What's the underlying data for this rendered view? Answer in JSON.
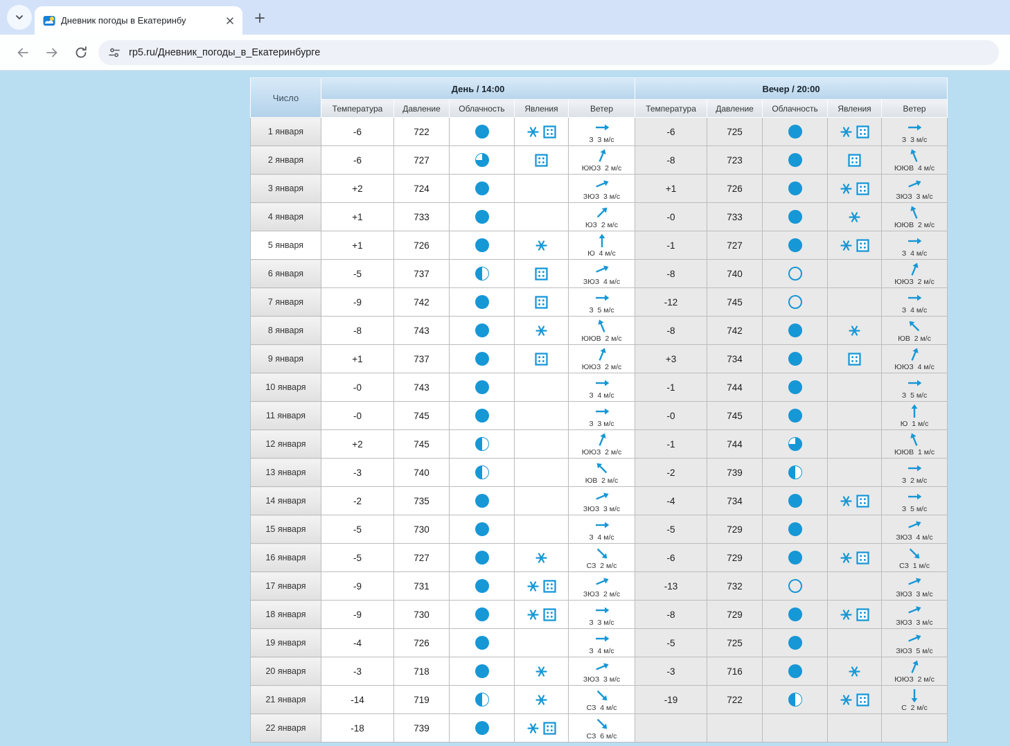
{
  "browser": {
    "tab_title": "Дневник погоды в Екатеринбу",
    "url": "rp5.ru/Дневник_погоды_в_Екатеринбурге"
  },
  "colors": {
    "accent": "#1697d6",
    "page_background": "#b9def2",
    "header_blue_top": "#d8eaf8",
    "header_blue_bottom": "#b7d4eb",
    "evening_cell": "#e9e9e9"
  },
  "table": {
    "date_header": "Число",
    "groups": [
      {
        "label": "День / 14:00"
      },
      {
        "label": "Вечер / 20:00"
      }
    ],
    "columns": [
      "Температура",
      "Давление",
      "Облачность",
      "Явления",
      "Ветер"
    ],
    "wind_unit": "м/с",
    "cloud_legend": {
      "overcast": "сплошная облачность",
      "mostly": "облачно",
      "half": "переменная облачность",
      "clear": "ясно"
    },
    "rows": [
      {
        "date": "1 января",
        "highlighted": false,
        "day": {
          "temp": "-6",
          "pressure": "722",
          "cloud": "overcast",
          "phenomena": [
            "snowflake",
            "dotted-box"
          ],
          "wind_dir": "З",
          "wind_speed": "3"
        },
        "evening": {
          "temp": "-6",
          "pressure": "725",
          "cloud": "overcast",
          "phenomena": [
            "snowflake",
            "dotted-box"
          ],
          "wind_dir": "З",
          "wind_speed": "3"
        }
      },
      {
        "date": "2 января",
        "highlighted": false,
        "day": {
          "temp": "-6",
          "pressure": "727",
          "cloud": "mostly",
          "phenomena": [
            "dotted-box"
          ],
          "wind_dir": "ЮЮЗ",
          "wind_speed": "2"
        },
        "evening": {
          "temp": "-8",
          "pressure": "723",
          "cloud": "overcast",
          "phenomena": [
            "dotted-box"
          ],
          "wind_dir": "ЮЮВ",
          "wind_speed": "4"
        }
      },
      {
        "date": "3 января",
        "highlighted": false,
        "day": {
          "temp": "+2",
          "pressure": "724",
          "cloud": "overcast",
          "phenomena": [],
          "wind_dir": "ЗЮЗ",
          "wind_speed": "3"
        },
        "evening": {
          "temp": "+1",
          "pressure": "726",
          "cloud": "overcast",
          "phenomena": [
            "snowflake",
            "dotted-box"
          ],
          "wind_dir": "ЗЮЗ",
          "wind_speed": "3"
        }
      },
      {
        "date": "4 января",
        "highlighted": false,
        "day": {
          "temp": "+1",
          "pressure": "733",
          "cloud": "overcast",
          "phenomena": [],
          "wind_dir": "ЮЗ",
          "wind_speed": "2"
        },
        "evening": {
          "temp": "-0",
          "pressure": "733",
          "cloud": "overcast",
          "phenomena": [
            "snowflake"
          ],
          "wind_dir": "ЮЮВ",
          "wind_speed": "2"
        }
      },
      {
        "date": "5 января",
        "highlighted": true,
        "day": {
          "temp": "+1",
          "pressure": "726",
          "cloud": "overcast",
          "phenomena": [
            "snowflake"
          ],
          "wind_dir": "Ю",
          "wind_speed": "4"
        },
        "evening": {
          "temp": "-1",
          "pressure": "727",
          "cloud": "overcast",
          "phenomena": [
            "snowflake",
            "dotted-box"
          ],
          "wind_dir": "З",
          "wind_speed": "4"
        }
      },
      {
        "date": "6 января",
        "highlighted": false,
        "day": {
          "temp": "-5",
          "pressure": "737",
          "cloud": "half",
          "phenomena": [
            "dotted-box"
          ],
          "wind_dir": "ЗЮЗ",
          "wind_speed": "4"
        },
        "evening": {
          "temp": "-8",
          "pressure": "740",
          "cloud": "clear",
          "phenomena": [],
          "wind_dir": "ЮЮЗ",
          "wind_speed": "2"
        }
      },
      {
        "date": "7 января",
        "highlighted": false,
        "day": {
          "temp": "-9",
          "pressure": "742",
          "cloud": "overcast",
          "phenomena": [
            "dotted-box"
          ],
          "wind_dir": "З",
          "wind_speed": "5"
        },
        "evening": {
          "temp": "-12",
          "pressure": "745",
          "cloud": "clear",
          "phenomena": [],
          "wind_dir": "З",
          "wind_speed": "4"
        }
      },
      {
        "date": "8 января",
        "highlighted": false,
        "day": {
          "temp": "-8",
          "pressure": "743",
          "cloud": "overcast",
          "phenomena": [
            "snowflake"
          ],
          "wind_dir": "ЮЮВ",
          "wind_speed": "2"
        },
        "evening": {
          "temp": "-8",
          "pressure": "742",
          "cloud": "overcast",
          "phenomena": [
            "snowflake"
          ],
          "wind_dir": "ЮВ",
          "wind_speed": "2"
        }
      },
      {
        "date": "9 января",
        "highlighted": false,
        "day": {
          "temp": "+1",
          "pressure": "737",
          "cloud": "overcast",
          "phenomena": [
            "dotted-box"
          ],
          "wind_dir": "ЮЮЗ",
          "wind_speed": "2"
        },
        "evening": {
          "temp": "+3",
          "pressure": "734",
          "cloud": "overcast",
          "phenomena": [
            "dotted-box"
          ],
          "wind_dir": "ЮЮЗ",
          "wind_speed": "4"
        }
      },
      {
        "date": "10 января",
        "highlighted": false,
        "day": {
          "temp": "-0",
          "pressure": "743",
          "cloud": "overcast",
          "phenomena": [],
          "wind_dir": "З",
          "wind_speed": "4"
        },
        "evening": {
          "temp": "-1",
          "pressure": "744",
          "cloud": "overcast",
          "phenomena": [],
          "wind_dir": "З",
          "wind_speed": "5"
        }
      },
      {
        "date": "11 января",
        "highlighted": false,
        "day": {
          "temp": "-0",
          "pressure": "745",
          "cloud": "overcast",
          "phenomena": [],
          "wind_dir": "З",
          "wind_speed": "3"
        },
        "evening": {
          "temp": "-0",
          "pressure": "745",
          "cloud": "overcast",
          "phenomena": [],
          "wind_dir": "Ю",
          "wind_speed": "1"
        }
      },
      {
        "date": "12 января",
        "highlighted": false,
        "day": {
          "temp": "+2",
          "pressure": "745",
          "cloud": "half",
          "phenomena": [],
          "wind_dir": "ЮЮЗ",
          "wind_speed": "2"
        },
        "evening": {
          "temp": "-1",
          "pressure": "744",
          "cloud": "mostly",
          "phenomena": [],
          "wind_dir": "ЮЮВ",
          "wind_speed": "1"
        }
      },
      {
        "date": "13 января",
        "highlighted": false,
        "day": {
          "temp": "-3",
          "pressure": "740",
          "cloud": "half",
          "phenomena": [],
          "wind_dir": "ЮВ",
          "wind_speed": "2"
        },
        "evening": {
          "temp": "-2",
          "pressure": "739",
          "cloud": "half",
          "phenomena": [],
          "wind_dir": "З",
          "wind_speed": "2"
        }
      },
      {
        "date": "14 января",
        "highlighted": false,
        "day": {
          "temp": "-2",
          "pressure": "735",
          "cloud": "overcast",
          "phenomena": [],
          "wind_dir": "ЗЮЗ",
          "wind_speed": "3"
        },
        "evening": {
          "temp": "-4",
          "pressure": "734",
          "cloud": "overcast",
          "phenomena": [
            "snowflake",
            "dotted-box"
          ],
          "wind_dir": "З",
          "wind_speed": "5"
        }
      },
      {
        "date": "15 января",
        "highlighted": false,
        "day": {
          "temp": "-5",
          "pressure": "730",
          "cloud": "overcast",
          "phenomena": [],
          "wind_dir": "З",
          "wind_speed": "4"
        },
        "evening": {
          "temp": "-5",
          "pressure": "729",
          "cloud": "overcast",
          "phenomena": [],
          "wind_dir": "ЗЮЗ",
          "wind_speed": "4"
        }
      },
      {
        "date": "16 января",
        "highlighted": false,
        "day": {
          "temp": "-5",
          "pressure": "727",
          "cloud": "overcast",
          "phenomena": [
            "snowflake"
          ],
          "wind_dir": "СЗ",
          "wind_speed": "2"
        },
        "evening": {
          "temp": "-6",
          "pressure": "729",
          "cloud": "overcast",
          "phenomena": [
            "snowflake",
            "dotted-box"
          ],
          "wind_dir": "СЗ",
          "wind_speed": "1"
        }
      },
      {
        "date": "17 января",
        "highlighted": false,
        "day": {
          "temp": "-9",
          "pressure": "731",
          "cloud": "overcast",
          "phenomena": [
            "snowflake",
            "dotted-box"
          ],
          "wind_dir": "ЗЮЗ",
          "wind_speed": "2"
        },
        "evening": {
          "temp": "-13",
          "pressure": "732",
          "cloud": "clear",
          "phenomena": [],
          "wind_dir": "ЗЮЗ",
          "wind_speed": "3"
        }
      },
      {
        "date": "18 января",
        "highlighted": false,
        "day": {
          "temp": "-9",
          "pressure": "730",
          "cloud": "overcast",
          "phenomena": [
            "snowflake",
            "dotted-box"
          ],
          "wind_dir": "З",
          "wind_speed": "3"
        },
        "evening": {
          "temp": "-8",
          "pressure": "729",
          "cloud": "overcast",
          "phenomena": [
            "snowflake",
            "dotted-box"
          ],
          "wind_dir": "ЗЮЗ",
          "wind_speed": "3"
        }
      },
      {
        "date": "19 января",
        "highlighted": false,
        "day": {
          "temp": "-4",
          "pressure": "726",
          "cloud": "overcast",
          "phenomena": [],
          "wind_dir": "З",
          "wind_speed": "4"
        },
        "evening": {
          "temp": "-5",
          "pressure": "725",
          "cloud": "overcast",
          "phenomena": [],
          "wind_dir": "ЗЮЗ",
          "wind_speed": "5"
        }
      },
      {
        "date": "20 января",
        "highlighted": false,
        "day": {
          "temp": "-3",
          "pressure": "718",
          "cloud": "overcast",
          "phenomena": [
            "snowflake"
          ],
          "wind_dir": "ЗЮЗ",
          "wind_speed": "3"
        },
        "evening": {
          "temp": "-3",
          "pressure": "716",
          "cloud": "overcast",
          "phenomena": [
            "snowflake"
          ],
          "wind_dir": "ЮЮЗ",
          "wind_speed": "2"
        }
      },
      {
        "date": "21 января",
        "highlighted": false,
        "day": {
          "temp": "-14",
          "pressure": "719",
          "cloud": "half",
          "phenomena": [
            "snowflake"
          ],
          "wind_dir": "СЗ",
          "wind_speed": "4"
        },
        "evening": {
          "temp": "-19",
          "pressure": "722",
          "cloud": "half",
          "phenomena": [
            "snowflake",
            "dotted-box"
          ],
          "wind_dir": "С",
          "wind_speed": "2"
        }
      },
      {
        "date": "22 января",
        "highlighted": false,
        "day": {
          "temp": "-18",
          "pressure": "739",
          "cloud": "overcast",
          "phenomena": [
            "snowflake",
            "dotted-box"
          ],
          "wind_dir": "СЗ",
          "wind_speed": "6"
        },
        "evening": null
      }
    ]
  }
}
